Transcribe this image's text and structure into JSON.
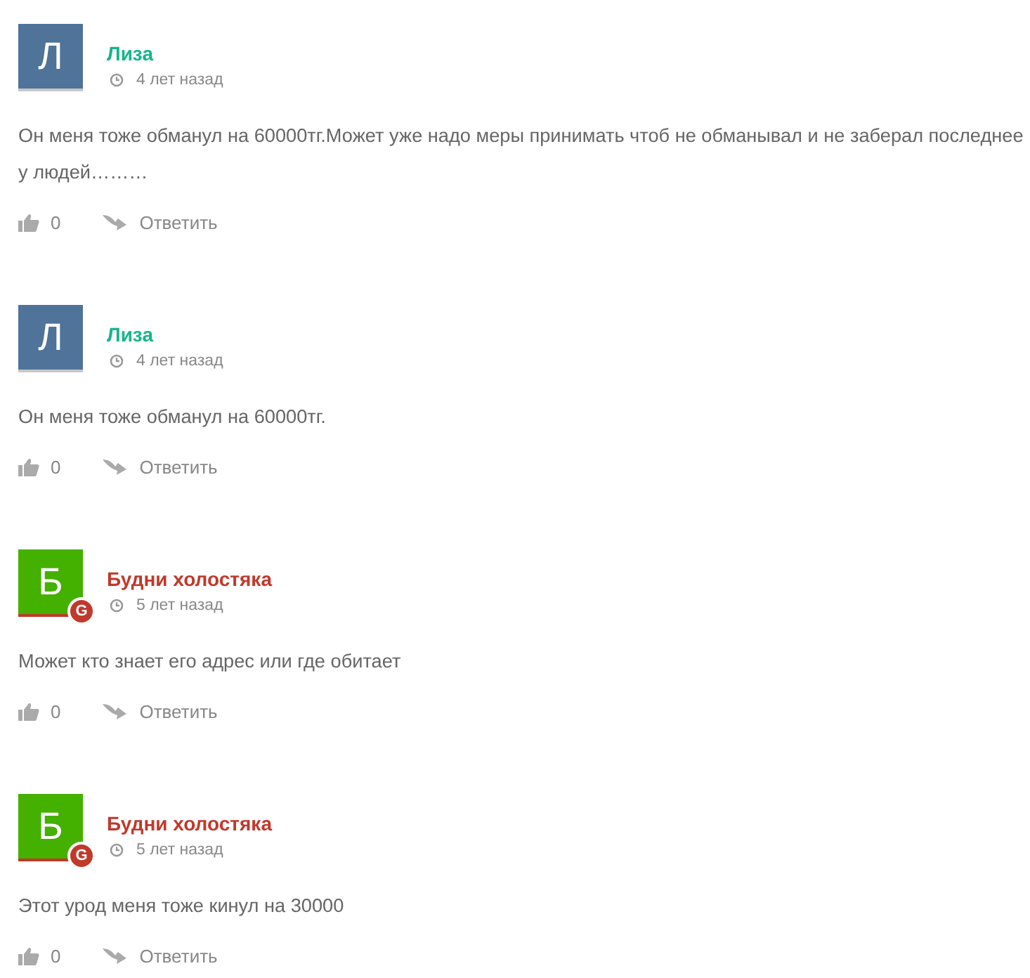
{
  "comments": [
    {
      "kind": "guest",
      "initial": "Л",
      "color": "#4f7399",
      "author": "Лиза",
      "time": "4 лет назад",
      "text": "Он меня тоже обманул на 60000тг.Может уже надо меры принимать чтоб не обманывал и не заберал последнее у людей………",
      "likes": "0",
      "reply": "Ответить"
    },
    {
      "kind": "guest",
      "initial": "Л",
      "color": "#4f7399",
      "author": "Лиза",
      "time": "4 лет назад",
      "text": "Он меня тоже обманул на 60000тг.",
      "likes": "0",
      "reply": "Ответить"
    },
    {
      "kind": "google",
      "initial": "Б",
      "color": "#44b000",
      "badge": "G",
      "author": "Будни холостяка",
      "time": "5 лет назад",
      "text": "Может кто знает его адрес или где обитает",
      "likes": "0",
      "reply": "Ответить"
    },
    {
      "kind": "google",
      "initial": "Б",
      "color": "#44b000",
      "badge": "G",
      "author": "Будни холостяка",
      "time": "5 лет назад",
      "text": "Этот урод меня тоже кинул на 30000",
      "likes": "0",
      "reply": "Ответить"
    }
  ]
}
